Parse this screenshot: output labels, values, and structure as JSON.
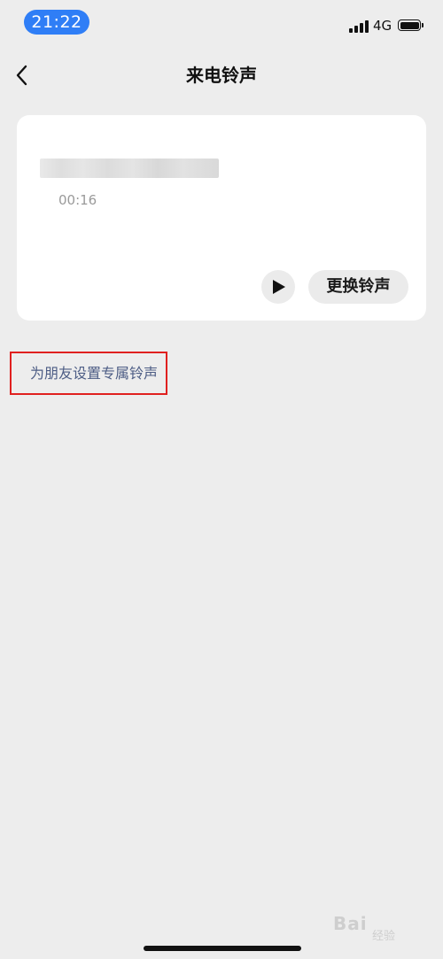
{
  "status_bar": {
    "time": "21:22",
    "network": "4G",
    "battery_level": 1.0,
    "icons": [
      "signal-icon",
      "battery-icon"
    ]
  },
  "nav": {
    "title": "来电铃声",
    "back_icon": "chevron-left-icon"
  },
  "ringtone": {
    "duration": "00:16",
    "play_icon": "play-icon",
    "change_label": "更换铃声"
  },
  "friend_link": {
    "label": "为朋友设置专属铃声",
    "highlight_color": "#e0201f"
  },
  "colors": {
    "accent": "#2f7ef6",
    "link": "#4d5d85",
    "background": "#ededed"
  },
  "watermark": {
    "text": "Bai",
    "sub": "经验"
  }
}
